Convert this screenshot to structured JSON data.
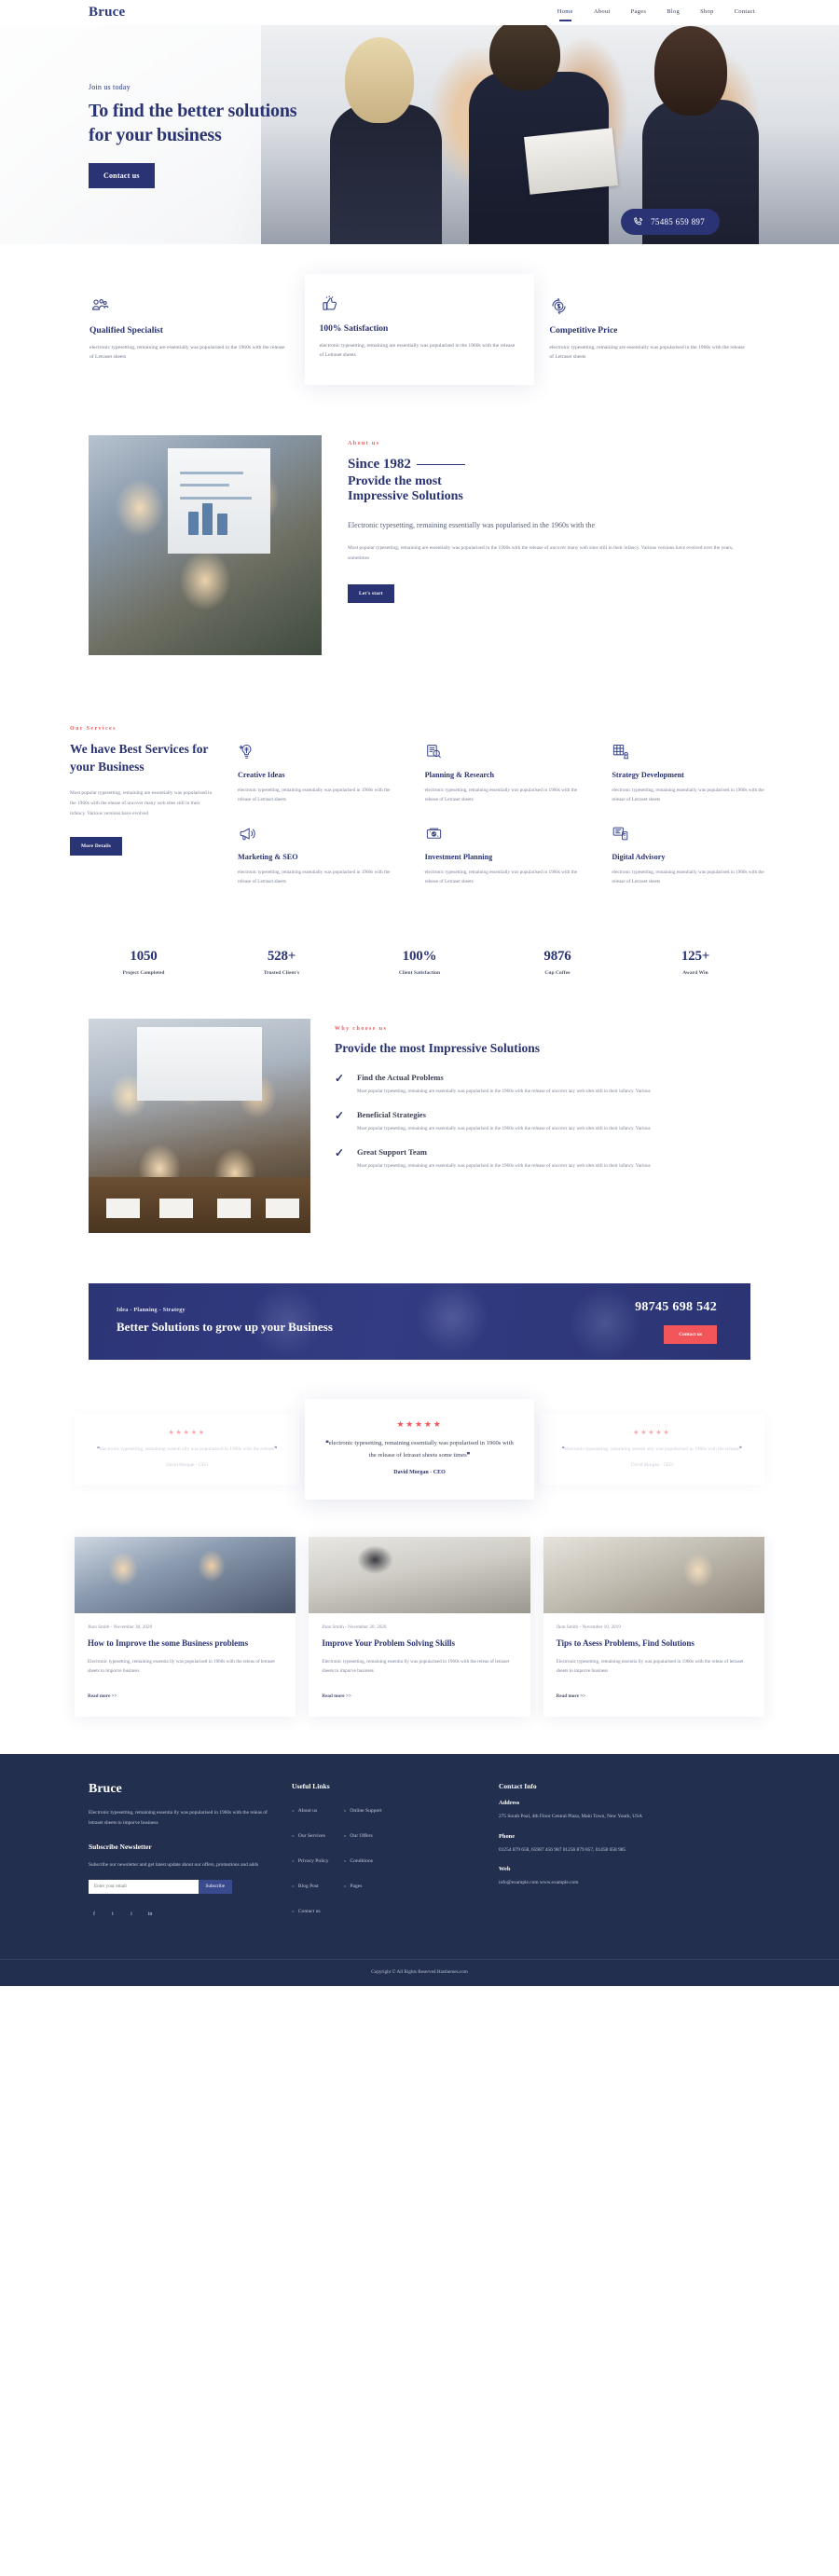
{
  "header": {
    "logo": "Bruce",
    "nav": [
      {
        "label": "Home",
        "active": true
      },
      {
        "label": "About",
        "active": false
      },
      {
        "label": "Pages",
        "active": false
      },
      {
        "label": "Blog",
        "active": false
      },
      {
        "label": "Shop",
        "active": false
      },
      {
        "label": "Contact",
        "active": false
      }
    ]
  },
  "hero": {
    "eyebrow": "Join us today",
    "title": "To find the better solutions for your business",
    "cta_label": "Contact us",
    "phone": "75485 659 897",
    "phone_icon": "phone-call-icon"
  },
  "features": [
    {
      "icon": "users-group-icon",
      "title": "Qualified Specialist",
      "text": "electronic typesetting, remaining are essentially was popularised in the 1960s with the release of Letraset sheets"
    },
    {
      "icon": "thumbs-up-icon",
      "title": "100% Satisfaction",
      "text": "electronic typesetting, remaining are essentially was popularised in the 1960s with the release of Letraset sheets"
    },
    {
      "icon": "price-tag-icon",
      "title": "Competitive Price",
      "text": "electronic typesetting, remaining are essentially was popularised in the 1960s with the release of Letraset sheets"
    }
  ],
  "about": {
    "eyebrow": "About us",
    "title_line1": "Since 1982",
    "title_line2": "Provide the most",
    "title_line3": "Impressive Solutions",
    "lead": "Electronic typesetting, remaining essentially was popularised in the 1960s with the",
    "sub": "Most popular typesetting, remaining are essentially was popularised in the 1960s with the release of uncover many web sites still in their infancy. Various versions have evolved over the years, sometimes",
    "cta_label": "Let's start"
  },
  "services": {
    "eyebrow": "Our Services",
    "title": "We have Best Services for your Business",
    "text": "Most popular typesetting, remaining are essentially was popularised in the 1960s with the elease of uncover many web sites still in their infancy. Various versions have evolved",
    "cta_label": "More Details",
    "items": [
      {
        "icon": "lightbulb-icon",
        "title": "Creative Ideas",
        "text": "electronic typesetting, remaining essentially was popularised in 1960s with the release of Letraset sheets"
      },
      {
        "icon": "magnifier-research-icon",
        "title": "Planning & Research",
        "text": "electronic typesetting, remaining essentially was popularised in 1960s with the release of Letraset sheets"
      },
      {
        "icon": "chess-strategy-icon",
        "title": "Strategy Development",
        "text": "electronic typesetting, remaining essentially was popularised in 1960s with the release of Letraset sheets"
      },
      {
        "icon": "megaphone-seo-icon",
        "title": "Marketing & SEO",
        "text": "electronic typesetting, remaining essentially was popularised in 1960s with the release of Letraset sheets"
      },
      {
        "icon": "money-growth-icon",
        "title": "Investment Planning",
        "text": "electronic typesetting, remaining essentially was popularised in 1960s with the release of Letraset sheets"
      },
      {
        "icon": "device-digital-icon",
        "title": "Digital Advisory",
        "text": "electronic typesetting, remaining essentially was popularised in 1960s with the release of Letraset sheets"
      }
    ]
  },
  "stats": [
    {
      "number": "1050",
      "label": "Project Completed"
    },
    {
      "number": "528+",
      "label": "Trusted Client's"
    },
    {
      "number": "100%",
      "label": "Client Satisfaction"
    },
    {
      "number": "9876",
      "label": "Cup Coffee"
    },
    {
      "number": "125+",
      "label": "Award Win"
    }
  ],
  "why": {
    "eyebrow": "Why choose us",
    "title": "Provide the most Impressive Solutions",
    "items": [
      {
        "title": "Find the Actual Problems",
        "text": "Most popular typesetting, remaining are essentially was popularised in the 1960s with the release of uncover any web sites still in their infancy. Various"
      },
      {
        "title": "Beneficial Strategies",
        "text": "Most popular typesetting, remaining are essentially was popularised in the 1960s with the release of uncover any web sites still in their infancy. Various"
      },
      {
        "title": "Great Support Team",
        "text": "Most popular typesetting, remaining are essentially was popularised in the 1960s with the release of uncover any web sites still in their infancy. Various"
      }
    ]
  },
  "cta_banner": {
    "eyebrow": "Idea - Planning - Strategy",
    "title": "Better Solutions to grow up your Business",
    "phone": "98745 698 542",
    "button_label": "Contact us"
  },
  "testimonials": [
    {
      "stars": "★★★★★",
      "quote": "electronic typesetting, remaining essenti ally was popularised in 1960s with the release",
      "author": "David Morgan - CEO",
      "active": false
    },
    {
      "stars": "★★★★★",
      "quote": "electronic typesetting, remaining essentially was popularised in 1960s with the release of letraset sheets some times",
      "author": "David Morgan - CEO",
      "active": true
    },
    {
      "stars": "★★★★★",
      "quote": "electronic typesetting, remaining essenti ally was popularised in 1960s with the release",
      "author": "David Morgan - CEO",
      "active": false
    }
  ],
  "blog": [
    {
      "meta": "Jhon Smith - November 30, 2020",
      "title": "How to Improve the some Business problems",
      "text": "Electronic typesetting, remaining essentia lly was popularised in 1960s with the releas of letraset sheets to imporve business",
      "link": "Read more >>"
    },
    {
      "meta": "Jhon Smith - November 20, 2020",
      "title": "Improve Your Problem Solving Skills",
      "text": "Electronic typesetting, remaining essentia lly was popularised in 1960s with the releas of letraset sheets to imporve business",
      "link": "Read more >>"
    },
    {
      "meta": "Jhon Smith - November 10, 2019",
      "title": "Tips to Asess Problems, Find Solutions",
      "text": "Electronic typesetting, remaining essentia lly was popularised in 1960s with the releas of letraset sheets to imporve business",
      "link": "Read more >>"
    }
  ],
  "footer": {
    "logo": "Bruce",
    "about_text": "Electronic typesetting, remaining essentia lly was popularised in 1960s with the releas of letraset sheets to imporve business",
    "subscribe_title": "Subscribe Newsletter",
    "subscribe_text": "Subscribe our newsletter and get latest update about our offers, promotions and adds",
    "subscribe_placeholder": "Enter your email",
    "subscribe_button": "Subscribe",
    "socials": [
      {
        "icon": "facebook-icon",
        "glyph": "f"
      },
      {
        "icon": "twitter-icon",
        "glyph": "t"
      },
      {
        "icon": "instagram-icon",
        "glyph": "i"
      },
      {
        "icon": "linkedin-icon",
        "glyph": "in"
      }
    ],
    "links_title": "Useful Links",
    "links_col1": [
      "About us",
      "Our Services",
      "Privacy Policy",
      "Blog Post",
      "Contact us"
    ],
    "links_col2": [
      "Online Support",
      "Our Offers",
      "Conditions",
      "Pages"
    ],
    "contact_title": "Contact Info",
    "address_label": "Address",
    "address_text": "275 South Poal, 4th Floor Central Plaza, Main Town, New Yourk, USA",
    "phone_label": "Phone",
    "phone_text": "01254 879 658, 65987 456 987 01256 879 857, 01458 658 985",
    "web_label": "Web",
    "web_text": "info@example.com www.example.com",
    "copyright": "Copyright © All Rights Reserved Hasthemes.com"
  },
  "colors": {
    "brand": "#2a3373",
    "accent_red": "#f2555a",
    "footer_bg": "#232f4f"
  }
}
